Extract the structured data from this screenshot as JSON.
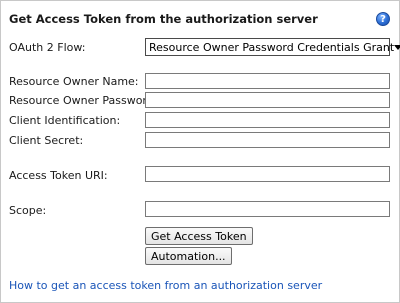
{
  "panel": {
    "title": "Get Access Token from the authorization server",
    "help_icon": "help-icon"
  },
  "form": {
    "flow": {
      "label": "OAuth 2 Flow:",
      "selected": "Resource Owner Password Credentials Grant"
    },
    "owner_name": {
      "label": "Resource Owner Name:",
      "value": ""
    },
    "owner_password": {
      "label": "Resource Owner Password:",
      "value": ""
    },
    "client_id": {
      "label": "Client Identification:",
      "value": ""
    },
    "client_secret": {
      "label": "Client Secret:",
      "value": ""
    },
    "token_uri": {
      "label": "Access Token URI:",
      "value": ""
    },
    "scope": {
      "label": "Scope:",
      "value": ""
    }
  },
  "buttons": {
    "get_token": "Get Access Token",
    "automation": "Automation..."
  },
  "help_link": "How to get an access token from an authorization server",
  "colors": {
    "link": "#1a55b8",
    "help_icon": "#2d6fd6"
  }
}
